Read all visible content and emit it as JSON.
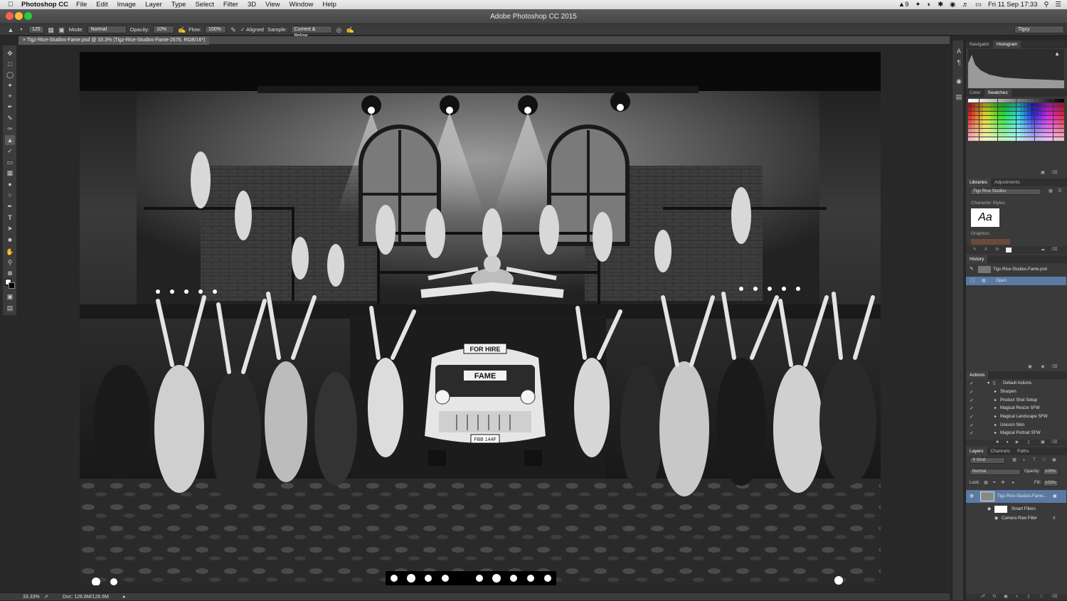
{
  "menubar": {
    "app": "Photoshop CC",
    "items": [
      "File",
      "Edit",
      "Image",
      "Layer",
      "Type",
      "Select",
      "Filter",
      "3D",
      "View",
      "Window",
      "Help"
    ],
    "status_right": {
      "adobe_badge": "9",
      "date_time": "Fri 11 Sep  17:33"
    }
  },
  "window": {
    "title": "Adobe Photoshop CC 2015"
  },
  "options_bar": {
    "brush_size": "125",
    "mode_label": "Mode:",
    "mode_value": "Normal",
    "opacity_label": "Opacity:",
    "opacity_value": "10%",
    "flow_label": "Flow:",
    "flow_value": "100%",
    "aligned_label": "Aligned",
    "sample_label": "Sample:",
    "sample_value": "Current & Below",
    "workspace": "Tigzy"
  },
  "document_tab": {
    "title": "Tigz-Rice-Studios-Fame.psd @ 33.3% (Tigz-Rice-Studios-Fame-2676, RGB/16*)"
  },
  "canvas": {
    "car_sign_top": "FOR HIRE",
    "car_sign_front": "FAME",
    "car_plate": "FBB 144F"
  },
  "status_bar": {
    "zoom": "33.33%",
    "doc": "Doc: 126.6M/126.6M"
  },
  "panels": {
    "navigator": {
      "tabs": [
        "Navigator",
        "Histogram"
      ],
      "active": 1
    },
    "color": {
      "tabs": [
        "Color",
        "Swatches"
      ],
      "active": 1
    },
    "libraries": {
      "tabs": [
        "Libraries",
        "Adjustments"
      ],
      "library_name": "Tigz Rice Studios",
      "character_styles_label": "Character Styles",
      "char_sample": "Aa",
      "graphics_label": "Graphics"
    },
    "history": {
      "title": "History",
      "snapshot": "Tigz-Rice-Studios-Fame.psd",
      "items": [
        "Open"
      ]
    },
    "actions": {
      "title": "Actions",
      "set": "Default Actions",
      "items": [
        "Sharpen",
        "Product Shot Setup",
        "Magical Resize SFW",
        "Magical Landscape SFW",
        "Unicorn Skin",
        "Magical Portrait SFW"
      ]
    },
    "layers": {
      "tabs": [
        "Layers",
        "Channels",
        "Paths"
      ],
      "filter_kind": "Kind",
      "blend_mode": "Normal",
      "opacity_label": "Opacity:",
      "opacity_value": "100%",
      "lock_label": "Lock:",
      "fill_label": "Fill:",
      "fill_value": "100%",
      "layer_name": "Tigz-Rice-Studios-Fame...",
      "smart_filters": "Smart Filters",
      "filter_name": "Camera Raw Filter"
    }
  },
  "colors": {
    "ui_dark": "#282828",
    "panel": "#3a3a3a",
    "selection": "#5a7aa3"
  }
}
